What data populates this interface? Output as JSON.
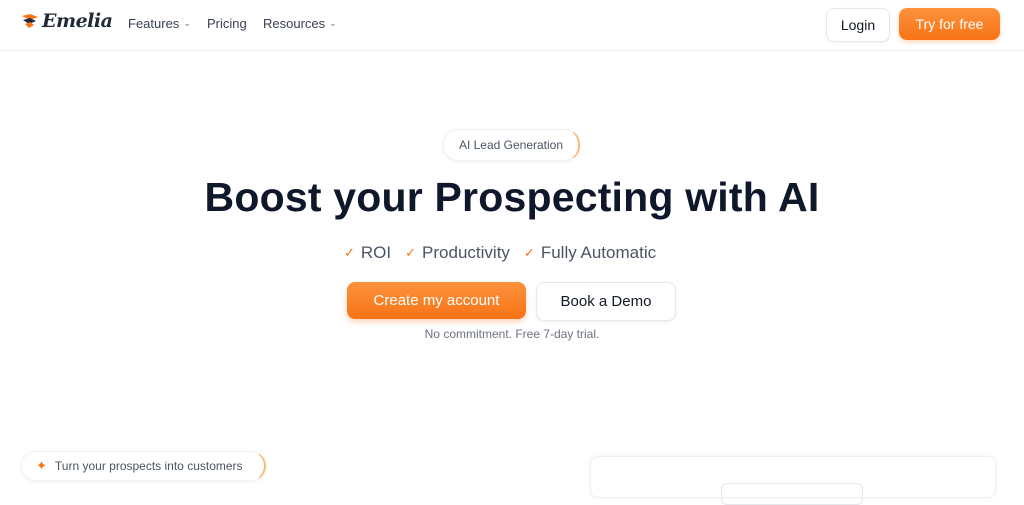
{
  "brand": {
    "name": "Emelia",
    "accent": "#f97316"
  },
  "nav": {
    "features": "Features",
    "pricing": "Pricing",
    "resources": "Resources",
    "login": "Login",
    "try_free": "Try for free"
  },
  "hero": {
    "badge": "AI Lead Generation",
    "title": "Boost your Prospecting with AI",
    "features": [
      "ROI",
      "Productivity",
      "Fully Automatic"
    ],
    "cta_primary": "Create my account",
    "cta_secondary": "Book a Demo",
    "note": "No commitment. Free 7-day trial."
  },
  "section": {
    "pill": "Turn your prospects into customers"
  }
}
